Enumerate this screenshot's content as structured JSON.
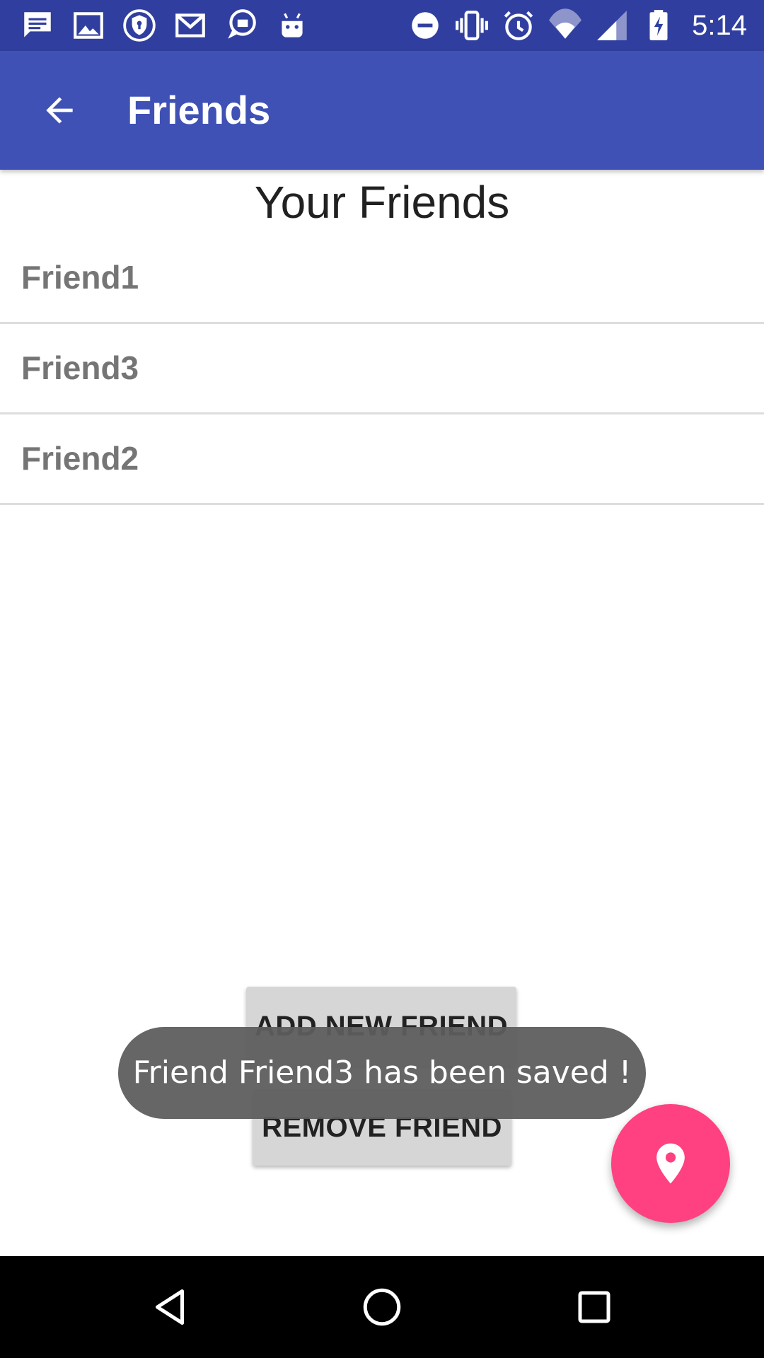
{
  "status_bar": {
    "time": "5:14",
    "left_icons": [
      "message-icon",
      "image-icon",
      "shield-icon",
      "gmail-icon",
      "chat-bubble-icon",
      "android-icon"
    ],
    "right_icons": [
      "do-not-disturb-icon",
      "vibrate-icon",
      "alarm-icon",
      "wifi-icon",
      "signal-icon",
      "battery-charging-icon"
    ]
  },
  "app_bar": {
    "title": "Friends",
    "back_icon": "arrow-back-icon",
    "color": "#3f51b5",
    "status_color": "#303f9f"
  },
  "content": {
    "title": "Your Friends",
    "friends": [
      "Friend1",
      "Friend3",
      "Friend2"
    ]
  },
  "buttons": {
    "add": "ADD NEW FRIEND",
    "remove": "REMOVE FRIEND"
  },
  "toast": {
    "message": "Friend Friend3 has been saved !"
  },
  "fab": {
    "icon": "location-pin-icon",
    "color": "#ff4081"
  },
  "nav_bar": {
    "icons": [
      "nav-back-icon",
      "nav-home-icon",
      "nav-recents-icon"
    ]
  }
}
